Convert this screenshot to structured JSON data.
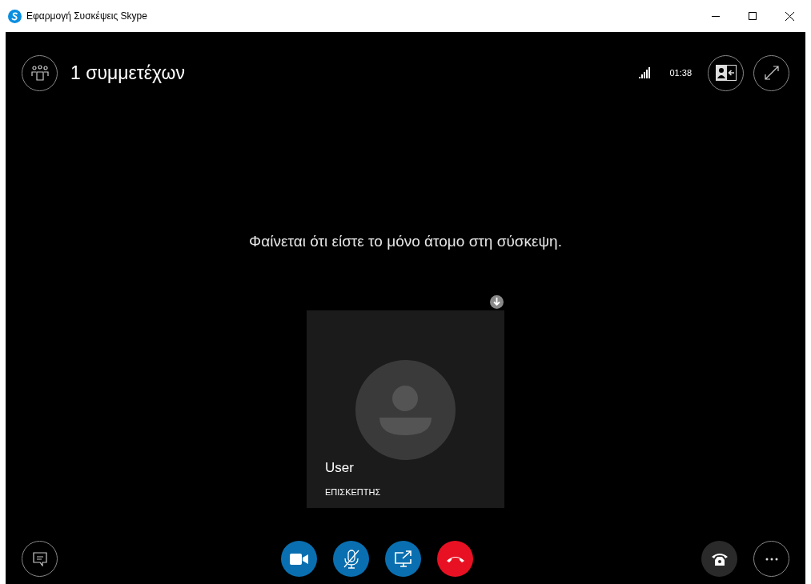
{
  "window": {
    "title": "Εφαρμογή Συσκέψεις Skype"
  },
  "header": {
    "participants": "1 συμμετέχων",
    "timer": "01:38"
  },
  "message": "Φαίνεται ότι είστε το μόνο άτομο στη σύσκεψη.",
  "tile": {
    "name": "User",
    "role": "ΕΠΙΣΚΕΠΤΗΣ"
  },
  "controls": [
    {
      "kind": "video"
    },
    {
      "kind": "mic",
      "muted": true
    },
    {
      "kind": "share"
    },
    {
      "kind": "hangup"
    }
  ]
}
